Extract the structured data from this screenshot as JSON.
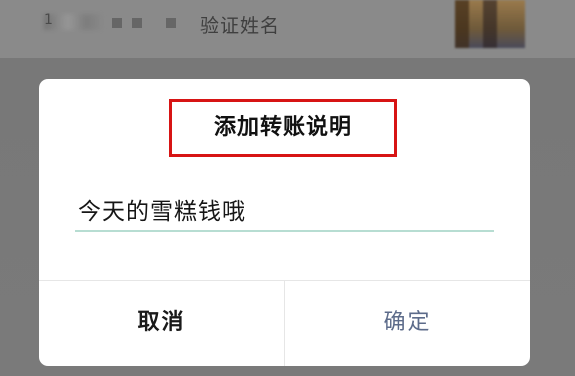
{
  "background": {
    "masked_account_text": "1",
    "verify_label": "验证姓名"
  },
  "dialog": {
    "title": "添加转账说明",
    "note_value": "今天的雪糕钱哦",
    "cancel_label": "取消",
    "confirm_label": "确定"
  },
  "colors": {
    "highlight_box": "#d71414",
    "input_underline": "#b7ddd2",
    "confirm_text": "#5c6b8a"
  }
}
